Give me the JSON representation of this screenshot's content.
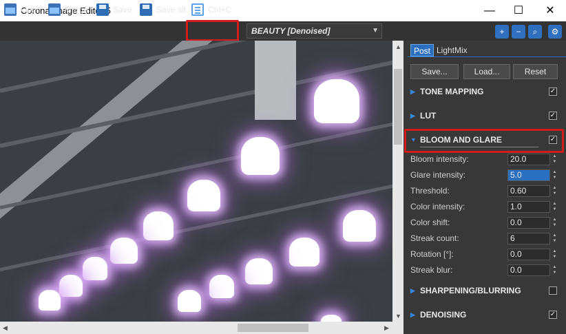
{
  "window": {
    "title": "Corona Image Editor 5",
    "minimize": "—",
    "maximize": "☐",
    "close": "✕"
  },
  "toolbar": {
    "open_label": "Open",
    "merge_label": "Merge",
    "save_label": "Save",
    "save_all_label": "Save all",
    "copy_label": "Ctrl+C",
    "pass_dropdown": "BEAUTY [Denoised]",
    "zoom_in": "+",
    "zoom_out": "−",
    "zoom_fit": "⌕",
    "settings": "⚙"
  },
  "panel": {
    "tabs": [
      "Post",
      "LightMix"
    ],
    "buttons": {
      "save": "Save...",
      "load": "Load...",
      "reset": "Reset"
    },
    "sections": {
      "tone_mapping": {
        "label": "TONE MAPPING",
        "enabled": true
      },
      "lut": {
        "label": "LUT",
        "enabled": true
      },
      "bloom_glare": {
        "label": "BLOOM AND GLARE",
        "enabled": true
      },
      "sharpening": {
        "label": "SHARPENING/BLURRING",
        "enabled": false
      },
      "denoising": {
        "label": "DENOISING",
        "enabled": true
      }
    },
    "bloom_rows": [
      {
        "label": "Bloom intensity:",
        "value": "20.0"
      },
      {
        "label": "Glare intensity:",
        "value": "5.0"
      },
      {
        "label": "Threshold:",
        "value": "0.60"
      },
      {
        "label": "Color intensity:",
        "value": "1.0"
      },
      {
        "label": "Color shift:",
        "value": "0.0"
      },
      {
        "label": "Streak count:",
        "value": "6"
      },
      {
        "label": "Rotation [°]:",
        "value": "0.0"
      },
      {
        "label": "Streak blur:",
        "value": "0.0"
      }
    ]
  },
  "colors": {
    "accent": "#2a6fc0",
    "highlight": "#d21b1b",
    "panel_bg": "#383838"
  }
}
